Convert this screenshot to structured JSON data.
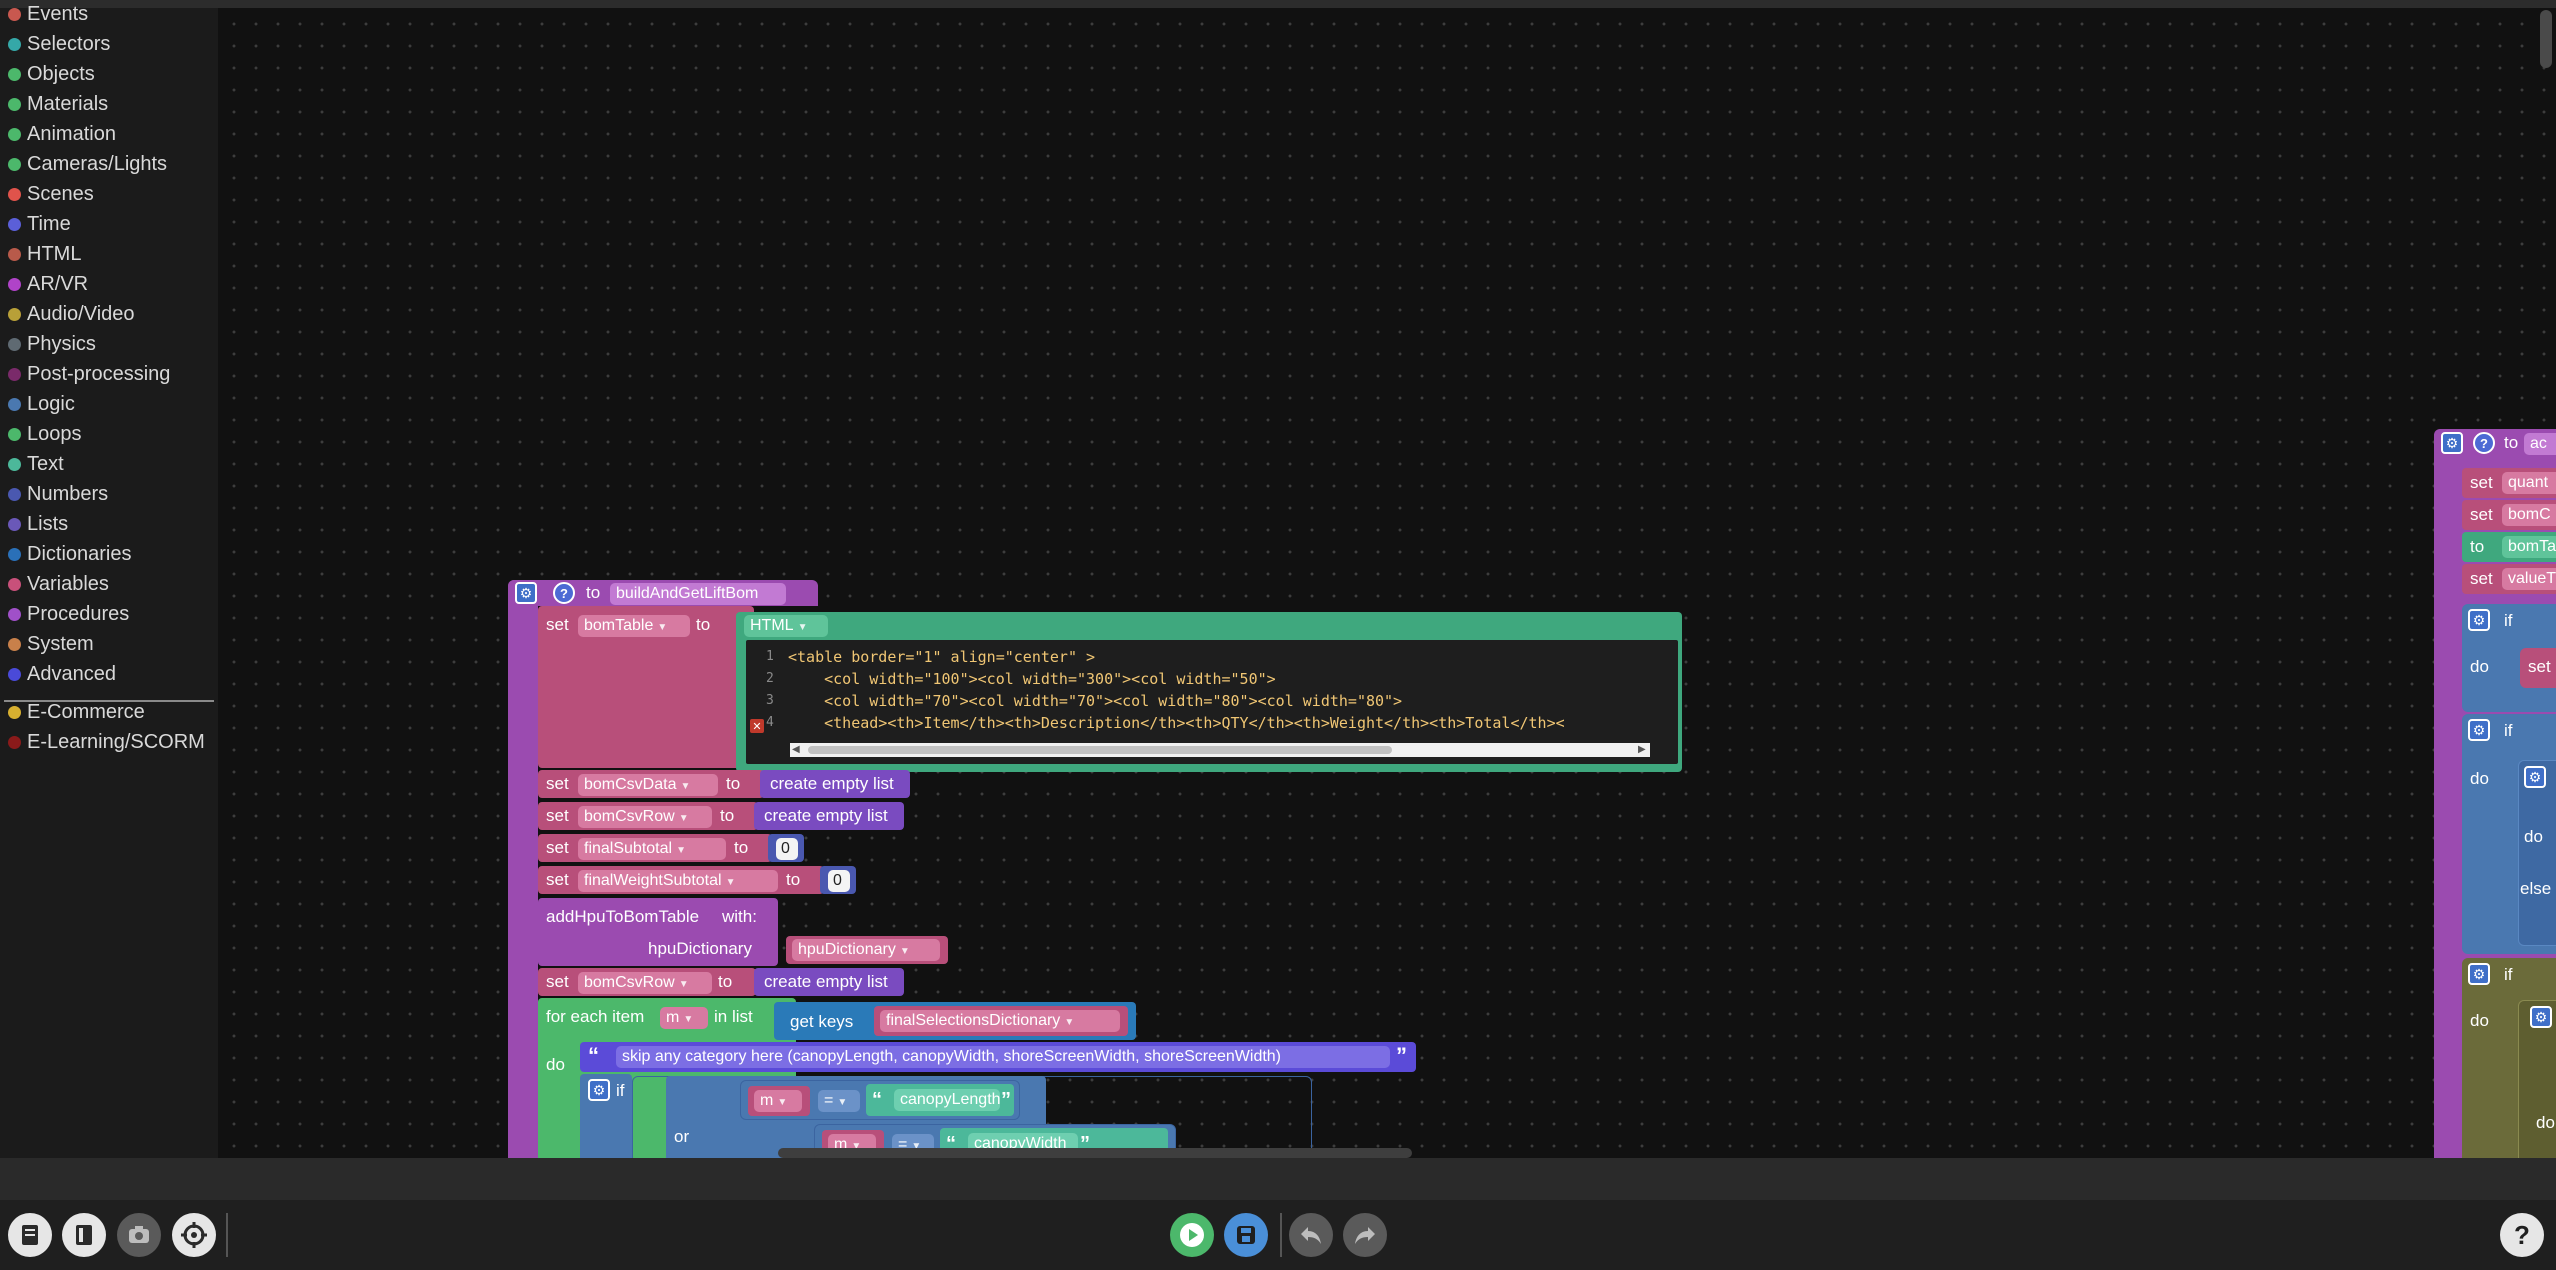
{
  "sidebar": {
    "categories": [
      {
        "label": "Events",
        "color": "#c8584f"
      },
      {
        "label": "Selectors",
        "color": "#35a8a8"
      },
      {
        "label": "Objects",
        "color": "#4cb86b"
      },
      {
        "label": "Materials",
        "color": "#4cb86b"
      },
      {
        "label": "Animation",
        "color": "#4cb86b"
      },
      {
        "label": "Cameras/Lights",
        "color": "#4cb86b"
      },
      {
        "label": "Scenes",
        "color": "#e0534b"
      },
      {
        "label": "Time",
        "color": "#5b5fd8"
      },
      {
        "label": "HTML",
        "color": "#b85a4a"
      },
      {
        "label": "AR/VR",
        "color": "#b043c8"
      },
      {
        "label": "Audio/Video",
        "color": "#b8a038"
      },
      {
        "label": "Physics",
        "color": "#5f6a72"
      },
      {
        "label": "Post-processing",
        "color": "#7a2a6a"
      },
      {
        "label": "Logic",
        "color": "#4a78b0"
      },
      {
        "label": "Loops",
        "color": "#4cb86b"
      },
      {
        "label": "Text",
        "color": "#4cb89a"
      },
      {
        "label": "Numbers",
        "color": "#4a58b0"
      },
      {
        "label": "Lists",
        "color": "#6a58b8"
      },
      {
        "label": "Dictionaries",
        "color": "#2a70b8"
      },
      {
        "label": "Variables",
        "color": "#c8507a"
      },
      {
        "label": "Procedures",
        "color": "#a050c8"
      },
      {
        "label": "System",
        "color": "#c8804a"
      },
      {
        "label": "Advanced",
        "color": "#4a4ad8"
      }
    ],
    "extensions": [
      {
        "label": "E-Commerce",
        "color": "#d8b030"
      },
      {
        "label": "E-Learning/SCORM",
        "color": "#8a1a1a"
      }
    ]
  },
  "procedure": {
    "to_label": "to",
    "name": "buildAndGetLiftBom",
    "set_label": "set",
    "to_kw": "to",
    "html_label": "HTML",
    "code_lines": [
      {
        "num": "1",
        "text": "<table border=\"1\" align=\"center\" >"
      },
      {
        "num": "2",
        "text": "    <col width=\"100\"><col width=\"300\"><col width=\"50\">"
      },
      {
        "num": "3",
        "text": "    <col width=\"70\"><col width=\"70\"><col width=\"80\"><col width=\"80\">"
      },
      {
        "num": "4",
        "text": "    <thead><th>Item</th><th>Description</th><th>QTY</th><th>Weight</th><th>Total</th><"
      }
    ],
    "vars": {
      "bomTable": "bomTable",
      "bomCsvData": "bomCsvData",
      "bomCsvRow": "bomCsvRow",
      "finalSubtotal": "finalSubtotal",
      "finalWeightSubtotal": "finalWeightSubtotal",
      "hpuDictionary": "hpuDictionary",
      "finalSelectionsDictionary": "finalSelectionsDictionary",
      "m": "m"
    },
    "create_empty_list": "create empty list",
    "zero": "0",
    "add_hpu": "addHpuToBomTable",
    "with_label": "with:",
    "hpu_param": "hpuDictionary",
    "for_each_item": "for each item",
    "in_list": "in list",
    "get_keys": "get keys",
    "do_label": "do",
    "comment": "skip any category here (canopyLength, canopyWidth, shoreScreenWidth, shoreScreenWidth)",
    "if_label": "if",
    "or_label": "or",
    "eq": "=",
    "canopyLength": "canopyLength",
    "canopyWidth": "canopyWidth"
  },
  "right_procedure": {
    "to_label": "to",
    "name_peek": "ac",
    "rows": [
      {
        "kw": "set",
        "field": "quant"
      },
      {
        "kw": "set",
        "field": "bomC"
      },
      {
        "kw": "to",
        "field": "bomTa"
      },
      {
        "kw": "set",
        "field": "valueT"
      }
    ],
    "if_label": "if",
    "do_label": "do",
    "else_label": "else",
    "set_label": "set"
  },
  "toolbar": {
    "icons": [
      "book-icon",
      "doc-icon",
      "camera-icon",
      "target-icon",
      "play-icon",
      "save-icon",
      "undo-icon",
      "redo-icon",
      "help-icon"
    ]
  }
}
